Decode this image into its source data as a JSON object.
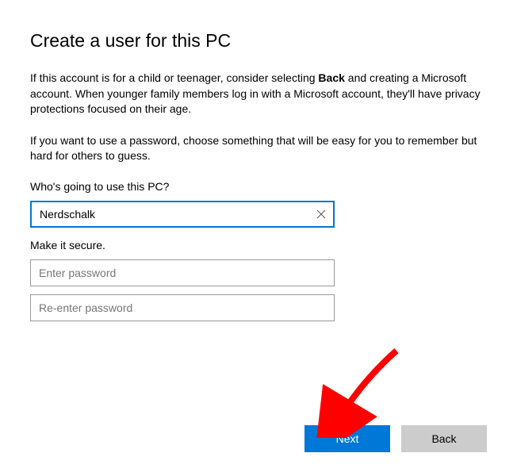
{
  "title": "Create a user for this PC",
  "paragraph1_a": "If this account is for a child or teenager, consider selecting ",
  "paragraph1_bold": "Back",
  "paragraph1_b": " and creating a Microsoft account. When younger family members log in with a Microsoft account, they'll have privacy protections focused on their age.",
  "paragraph2": "If you want to use a password, choose something that will be easy for you to remember but hard for others to guess.",
  "label_user": "Who's going to use this PC?",
  "username_value": "Nerdschalk",
  "label_secure": "Make it secure.",
  "password_placeholder": "Enter password",
  "password2_placeholder": "Re-enter password",
  "buttons": {
    "next": "Next",
    "back": "Back"
  }
}
